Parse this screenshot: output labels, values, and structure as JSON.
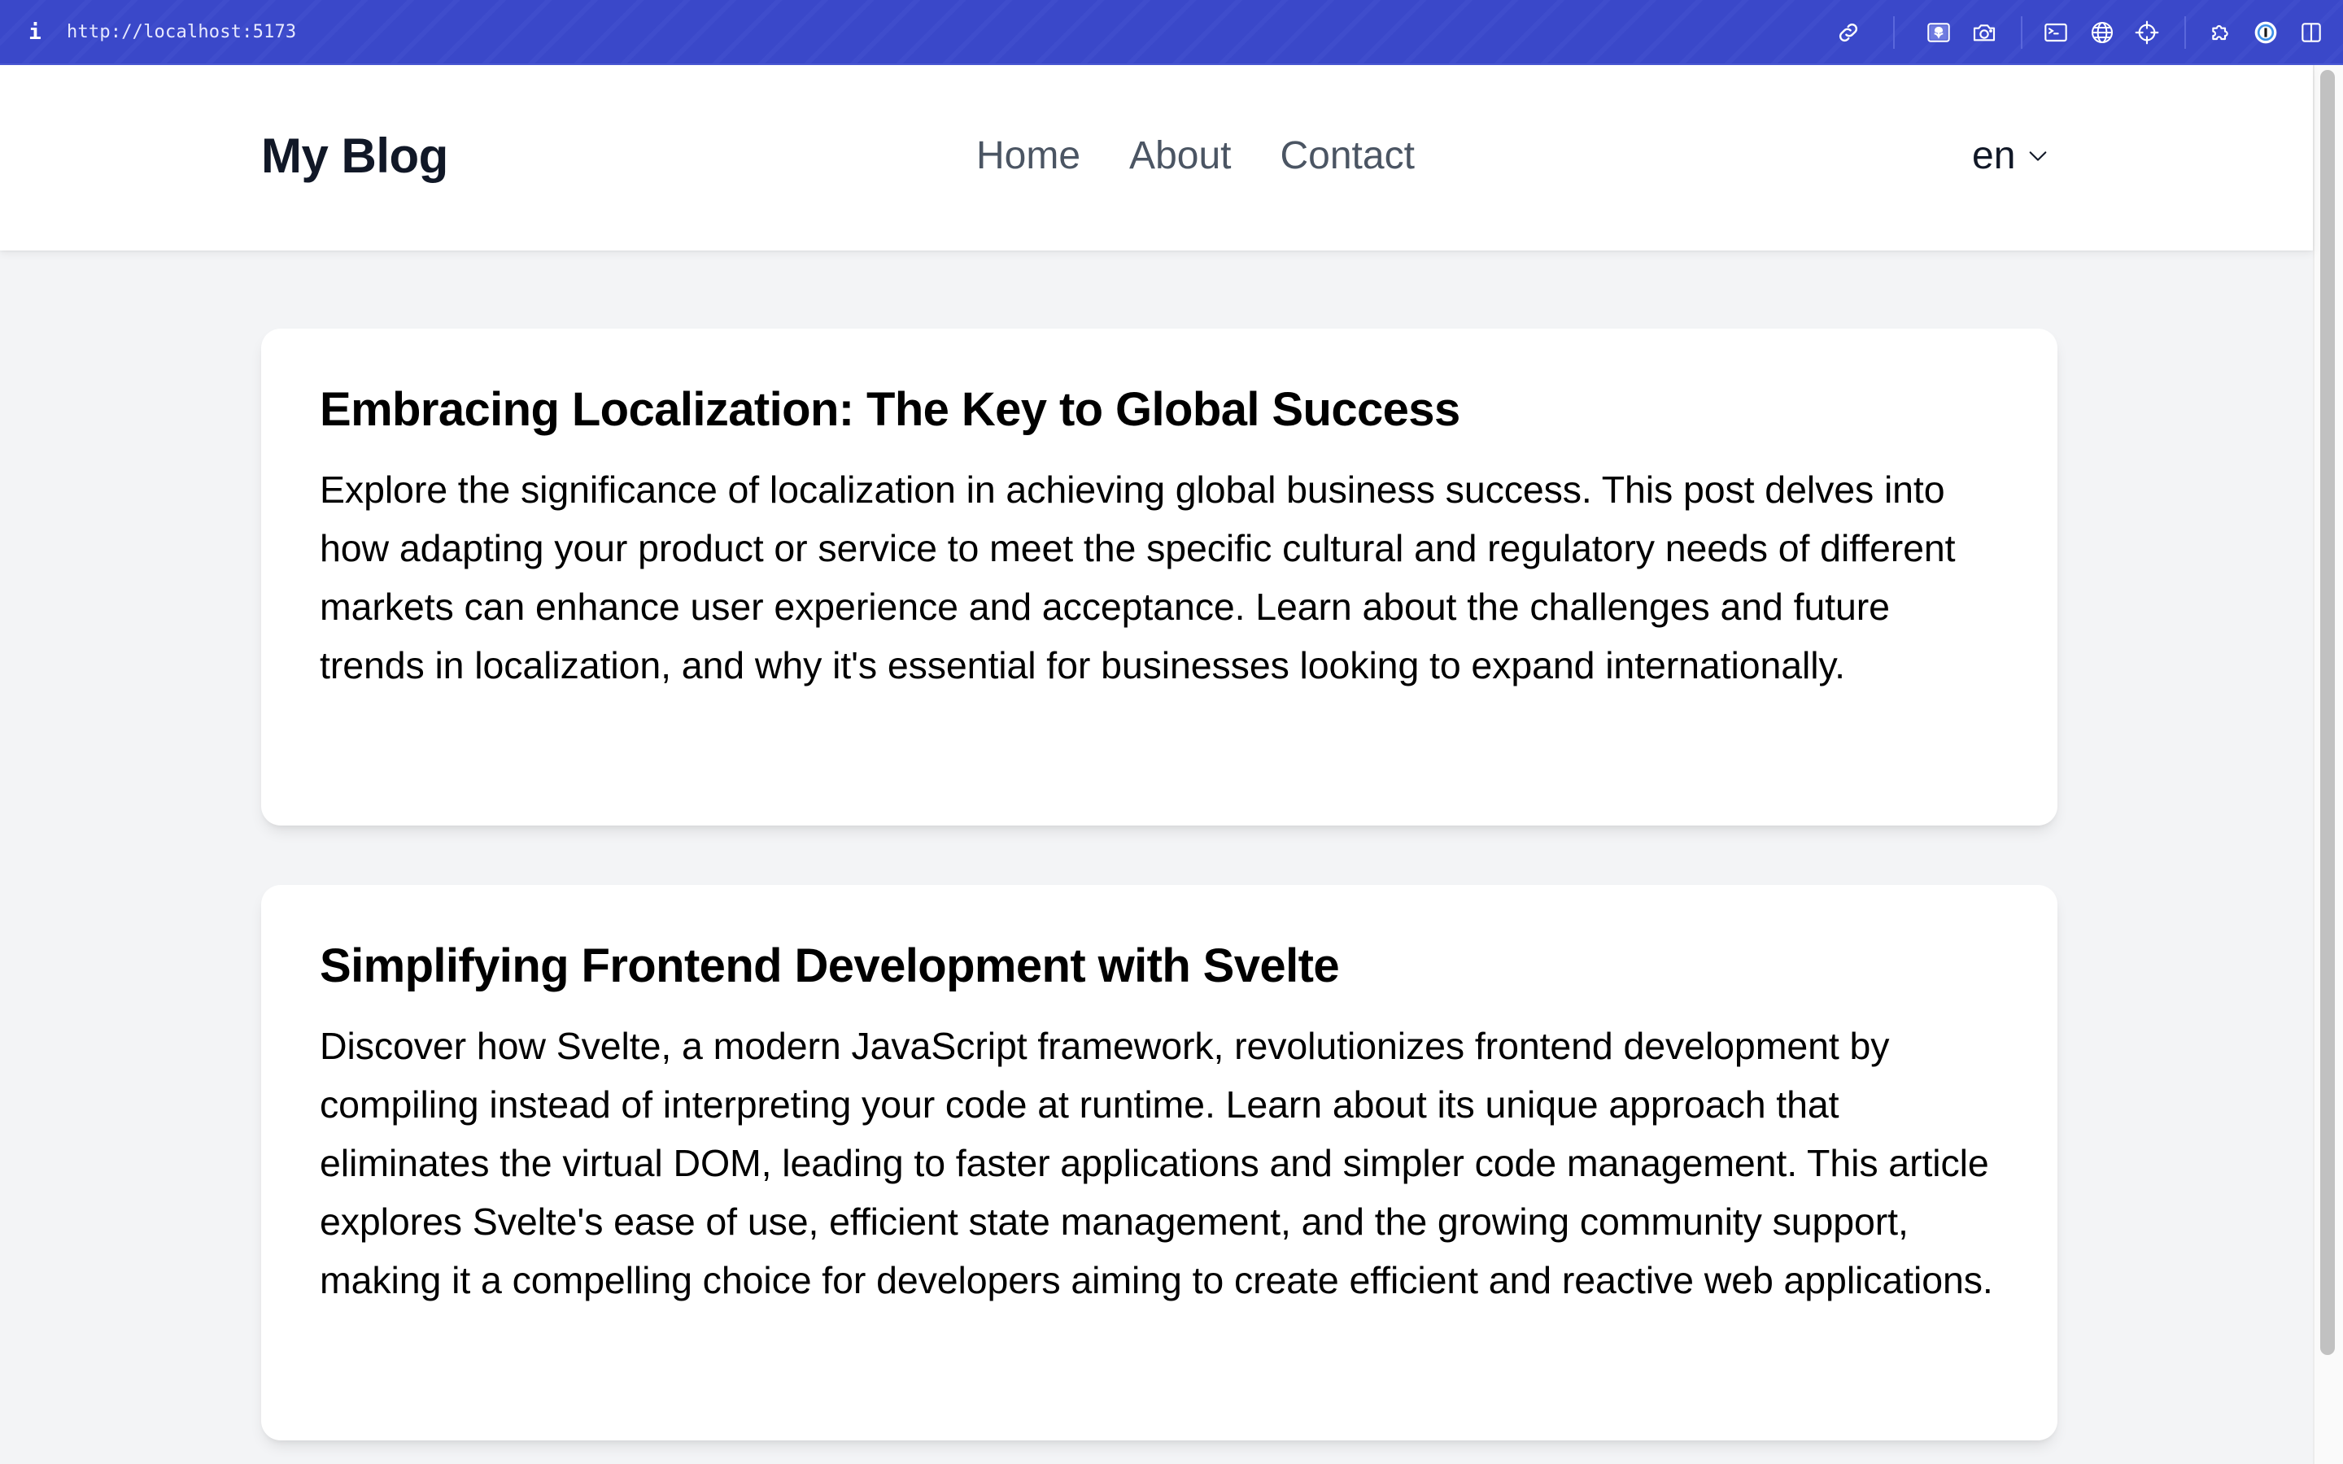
{
  "browser": {
    "url": "http://localhost:5173",
    "info_icon": "i",
    "toolbar_icons": [
      {
        "name": "link-icon"
      },
      {
        "name": "image-placeholder-icon"
      },
      {
        "name": "camera-icon"
      },
      {
        "name": "terminal-icon"
      },
      {
        "name": "globe-icon"
      },
      {
        "name": "crosshair-icon"
      },
      {
        "name": "extensions-puzzle-icon"
      },
      {
        "name": "password-manager-icon"
      },
      {
        "name": "split-view-icon"
      }
    ],
    "accent_color": "#3a48c9"
  },
  "header": {
    "site_title": "My Blog",
    "nav": [
      {
        "label": "Home"
      },
      {
        "label": "About"
      },
      {
        "label": "Contact"
      }
    ],
    "language": {
      "selected": "en"
    }
  },
  "posts": [
    {
      "title": "Embracing Localization: The Key to Global Success",
      "excerpt": "Explore the significance of localization in achieving global business success. This post delves into how adapting your product or service to meet the specific cultural and regulatory needs of different markets can enhance user experience and acceptance. Learn about the challenges and future trends in localization, and why it's essential for businesses looking to expand internationally."
    },
    {
      "title": "Simplifying Frontend Development with Svelte",
      "excerpt": "Discover how Svelte, a modern JavaScript framework, revolutionizes frontend development by compiling instead of interpreting your code at runtime. Learn about its unique approach that eliminates the virtual DOM, leading to faster applications and simpler code management. This article explores Svelte's ease of use, efficient state management, and the growing community support, making it a compelling choice for developers aiming to create efficient and reactive web applications."
    }
  ]
}
